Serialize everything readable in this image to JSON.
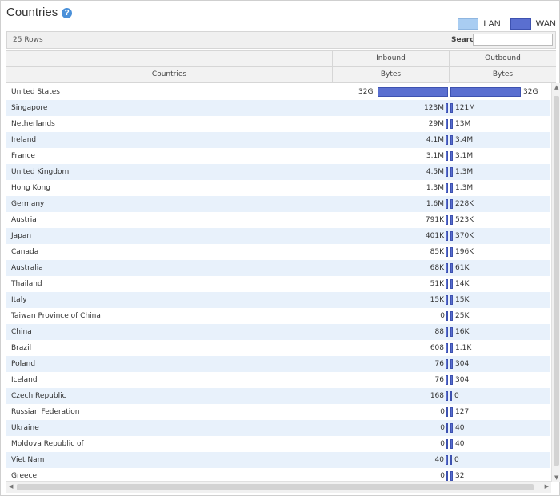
{
  "panel": {
    "title": "Countries",
    "help_icon": "question-circle-icon"
  },
  "legend": {
    "lan": "LAN",
    "wan": "WAN",
    "lan_color": "#a9cdf2",
    "wan_color": "#5a6fd0"
  },
  "toolbar": {
    "rows": "25 Rows",
    "search_label": "Search",
    "search_value": ""
  },
  "headers": {
    "countries": "Countries",
    "inbound": "Inbound",
    "outbound": "Outbound",
    "bytes_in": "Bytes",
    "bytes_out": "Bytes"
  },
  "rows": [
    {
      "country": "United States",
      "inbound": "32G",
      "outbound": "32G",
      "in_bytes": 32000000000,
      "out_bytes": 32000000000
    },
    {
      "country": "Singapore",
      "inbound": "123M",
      "outbound": "121M",
      "in_bytes": 123000000,
      "out_bytes": 121000000
    },
    {
      "country": "Netherlands",
      "inbound": "29M",
      "outbound": "13M",
      "in_bytes": 29000000,
      "out_bytes": 13000000
    },
    {
      "country": "Ireland",
      "inbound": "4.1M",
      "outbound": "3.4M",
      "in_bytes": 4100000,
      "out_bytes": 3400000
    },
    {
      "country": "France",
      "inbound": "3.1M",
      "outbound": "3.1M",
      "in_bytes": 3100000,
      "out_bytes": 3100000
    },
    {
      "country": "United Kingdom",
      "inbound": "4.5M",
      "outbound": "1.3M",
      "in_bytes": 4500000,
      "out_bytes": 1300000
    },
    {
      "country": "Hong Kong",
      "inbound": "1.3M",
      "outbound": "1.3M",
      "in_bytes": 1300000,
      "out_bytes": 1300000
    },
    {
      "country": "Germany",
      "inbound": "1.6M",
      "outbound": "228K",
      "in_bytes": 1600000,
      "out_bytes": 228000
    },
    {
      "country": "Austria",
      "inbound": "791K",
      "outbound": "523K",
      "in_bytes": 791000,
      "out_bytes": 523000
    },
    {
      "country": "Japan",
      "inbound": "401K",
      "outbound": "370K",
      "in_bytes": 401000,
      "out_bytes": 370000
    },
    {
      "country": "Canada",
      "inbound": "85K",
      "outbound": "196K",
      "in_bytes": 85000,
      "out_bytes": 196000
    },
    {
      "country": "Australia",
      "inbound": "68K",
      "outbound": "61K",
      "in_bytes": 68000,
      "out_bytes": 61000
    },
    {
      "country": "Thailand",
      "inbound": "51K",
      "outbound": "14K",
      "in_bytes": 51000,
      "out_bytes": 14000
    },
    {
      "country": "Italy",
      "inbound": "15K",
      "outbound": "15K",
      "in_bytes": 15000,
      "out_bytes": 15000
    },
    {
      "country": "Taiwan Province of China",
      "inbound": "0",
      "outbound": "25K",
      "in_bytes": 0,
      "out_bytes": 25000
    },
    {
      "country": "China",
      "inbound": "88",
      "outbound": "16K",
      "in_bytes": 88,
      "out_bytes": 16000
    },
    {
      "country": "Brazil",
      "inbound": "608",
      "outbound": "1.1K",
      "in_bytes": 608,
      "out_bytes": 1100
    },
    {
      "country": "Poland",
      "inbound": "76",
      "outbound": "304",
      "in_bytes": 76,
      "out_bytes": 304
    },
    {
      "country": "Iceland",
      "inbound": "76",
      "outbound": "304",
      "in_bytes": 76,
      "out_bytes": 304
    },
    {
      "country": "Czech Republic",
      "inbound": "168",
      "outbound": "0",
      "in_bytes": 168,
      "out_bytes": 0
    },
    {
      "country": "Russian Federation",
      "inbound": "0",
      "outbound": "127",
      "in_bytes": 0,
      "out_bytes": 127
    },
    {
      "country": "Ukraine",
      "inbound": "0",
      "outbound": "40",
      "in_bytes": 0,
      "out_bytes": 40
    },
    {
      "country": "Moldova Republic of",
      "inbound": "0",
      "outbound": "40",
      "in_bytes": 0,
      "out_bytes": 40
    },
    {
      "country": "Viet Nam",
      "inbound": "40",
      "outbound": "0",
      "in_bytes": 40,
      "out_bytes": 0
    },
    {
      "country": "Greece",
      "inbound": "0",
      "outbound": "32",
      "in_bytes": 0,
      "out_bytes": 32
    }
  ]
}
